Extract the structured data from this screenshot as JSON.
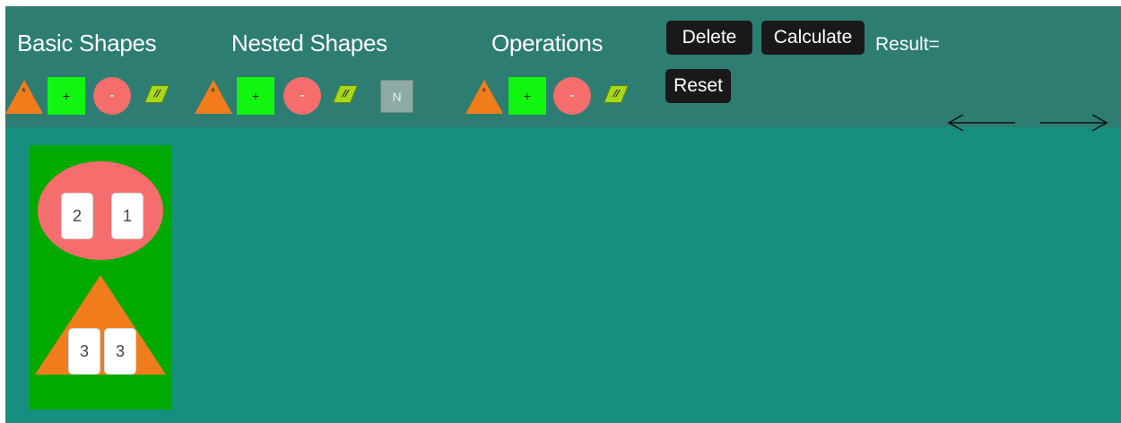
{
  "toolbar": {
    "sections": {
      "basic": "Basic Shapes",
      "nested": "Nested Shapes",
      "operations": "Operations"
    },
    "shape_symbols": {
      "multiply": "*",
      "add": "+",
      "subtract": "-",
      "divide": "//",
      "nested": "N"
    },
    "buttons": {
      "delete": "Delete",
      "calculate": "Calculate",
      "reset": "Reset"
    },
    "result_label": "Result="
  },
  "colors": {
    "workspace_bg": "#178f80",
    "toolbar_bg": "#2d7d73",
    "triangle": "#f07c1c",
    "square": "#11f511",
    "circle": "#f56d6d",
    "parallelogram": "#a8d81a",
    "nested_box": "#8eaaa4",
    "container": "#00aa00",
    "button_bg": "#191919"
  },
  "nav": {
    "left_arrow_icon": "arrow-left-icon",
    "right_arrow_icon": "arrow-right-icon"
  },
  "workspace": {
    "container": {
      "top_shape": "circle",
      "top_values": [
        "2",
        "1"
      ],
      "bottom_shape": "triangle",
      "bottom_values": [
        "3",
        "3"
      ]
    }
  }
}
